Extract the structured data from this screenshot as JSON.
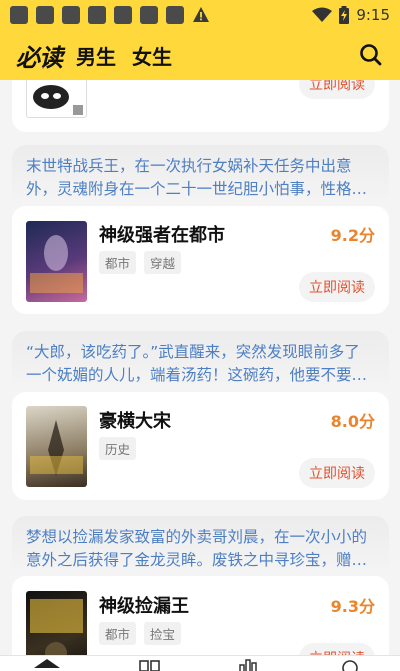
{
  "status_bar": {
    "time": "9:15",
    "icons": [
      "notification-icon",
      "warning-icon",
      "wifi-icon",
      "battery-charging-icon"
    ]
  },
  "app_bar": {
    "logo": "必读",
    "tabs": [
      "男生",
      "女生"
    ],
    "search_icon": "search-icon"
  },
  "colors": {
    "accent_yellow": "#ffd93b",
    "score_orange": "#e9862d",
    "read_button_red": "#e0522f",
    "quote_blue": "#4d7fc4"
  },
  "feed": {
    "partial_card": {
      "read_label": "立即阅读"
    },
    "items": [
      {
        "quote_lines": [
          "末世特战兵王，在一次执行女娲补天任务中出意",
          "外，灵魂附身在一个二十一世纪胆小怕事，性格…"
        ],
        "title": "神级强者在都市",
        "score": "9.2分",
        "tags": [
          "都市",
          "穿越"
        ],
        "read_label": "立即阅读"
      },
      {
        "quote_lines": [
          "“大郎，该吃药了。”武直醒来，突然发现眼前多了",
          "一个妩媚的人儿，端着汤药！这碗药，他要不要…"
        ],
        "title": "豪横大宋",
        "score": "8.0分",
        "tags": [
          "历史"
        ],
        "read_label": "立即阅读"
      },
      {
        "quote_lines": [
          "梦想以捡漏发家致富的外卖哥刘晨，在一次小小的",
          "意外之后获得了金龙灵眸。废铁之中寻珍宝，赠…"
        ],
        "title": "神级捡漏王",
        "score": "9.3分",
        "tags": [
          "都市",
          "捡宝"
        ],
        "read_label": "立即阅读"
      }
    ]
  },
  "bottom_nav": {
    "icons": [
      "home-icon",
      "bookshelf-icon",
      "ranking-icon",
      "profile-icon"
    ]
  }
}
